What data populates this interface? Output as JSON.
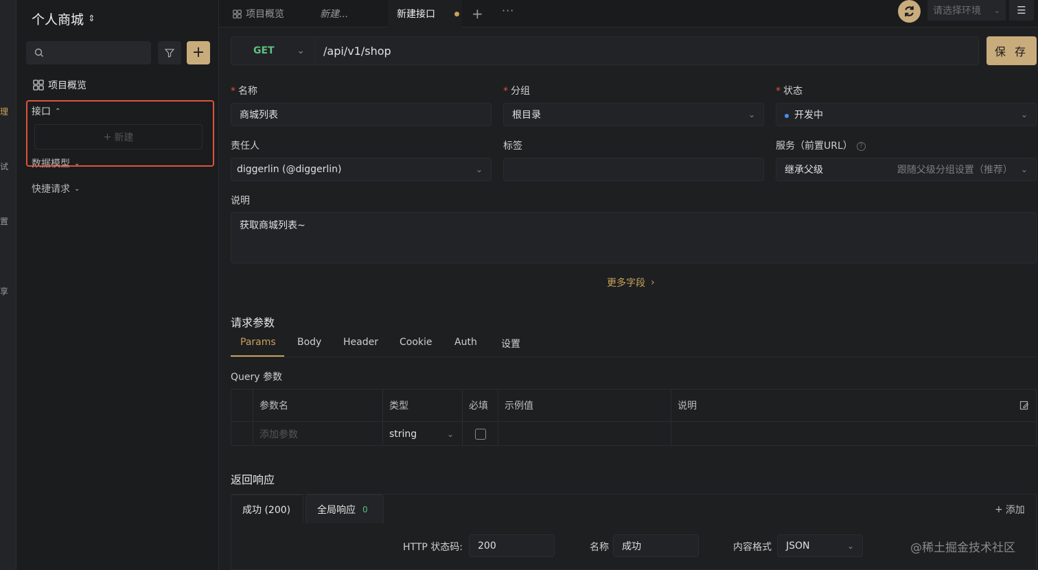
{
  "rail": {
    "labels": [
      "理",
      "试",
      "置",
      "享"
    ]
  },
  "sidebar": {
    "project_title": "个人商城",
    "overview_label": "项目概览",
    "api_section_label": "接口",
    "new_label": "新建",
    "data_model_label": "数据模型",
    "quick_request_label": "快捷请求"
  },
  "tabs": {
    "items": [
      {
        "label": "项目概览"
      },
      {
        "label": "新建..."
      },
      {
        "label": "新建接口"
      }
    ],
    "env_placeholder": "请选择环境"
  },
  "request": {
    "method": "GET",
    "url": "/api/v1/shop",
    "save_label": "保 存"
  },
  "form": {
    "name_label": "名称",
    "name_value": "商城列表",
    "group_label": "分组",
    "group_value": "根目录",
    "status_label": "状态",
    "status_value": "开发中",
    "owner_label": "责任人",
    "owner_value": "diggerlin (@diggerlin)",
    "tags_label": "标签",
    "tags_value": "",
    "service_label": "服务（前置URL）",
    "service_value": "继承父级",
    "service_hint": "跟随父级分组设置（推荐）",
    "description_label": "说明",
    "description_value": "获取商城列表~",
    "more_fields_label": "更多字段",
    "colors": {
      "accent": "#c9a15b",
      "required": "#e0533d",
      "status_dot": "#4a8ef0",
      "method": "#5fbf83"
    }
  },
  "params": {
    "title": "请求参数",
    "tabs": [
      "Params",
      "Body",
      "Header",
      "Cookie",
      "Auth",
      "设置"
    ],
    "active_tab": "Params",
    "query_label": "Query 参数",
    "columns": [
      "参数名",
      "类型",
      "必填",
      "示例值",
      "说明"
    ],
    "row": {
      "name_placeholder": "添加参数",
      "type": "string"
    }
  },
  "response": {
    "title": "返回响应",
    "tabs": [
      {
        "label": "成功 (200)"
      },
      {
        "label": "全局响应",
        "count": "0"
      }
    ],
    "add_label": "添加",
    "status_code_label": "HTTP 状态码:",
    "status_code_value": "200",
    "name_label": "名称",
    "name_value": "成功",
    "content_type_label": "内容格式",
    "content_type_value": "JSON"
  },
  "watermark": "@稀土掘金技术社区"
}
